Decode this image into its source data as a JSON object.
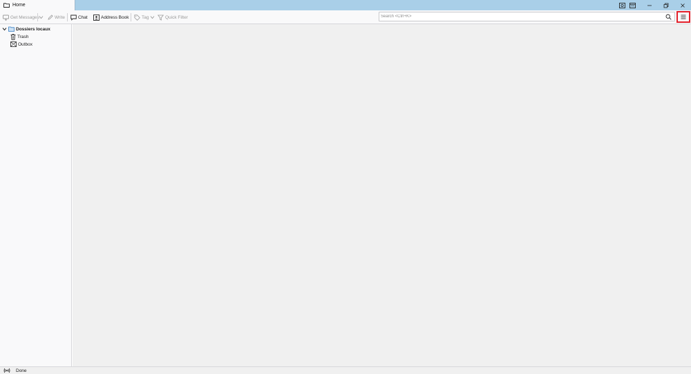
{
  "window": {
    "tab_title": "Home"
  },
  "toolbar": {
    "get_messages": "Get Messages",
    "write": "Write",
    "chat": "Chat",
    "address_book": "Address Book",
    "tag": "Tag",
    "quick_filter": "Quick Filter",
    "search_placeholder": "Search <Ctrl+K>",
    "search_value": ""
  },
  "folder_pane": {
    "account": "Dossiers locaux",
    "folders": [
      {
        "label": "Trash",
        "icon": "trash-icon"
      },
      {
        "label": "Outbox",
        "icon": "outbox-icon"
      }
    ]
  },
  "status_bar": {
    "text": "Done"
  },
  "colors": {
    "titlebar": "#a9cfe8",
    "toolbar": "#f9f9fa",
    "main_bg": "#f0f0f0",
    "highlight_border": "#e3202a"
  }
}
